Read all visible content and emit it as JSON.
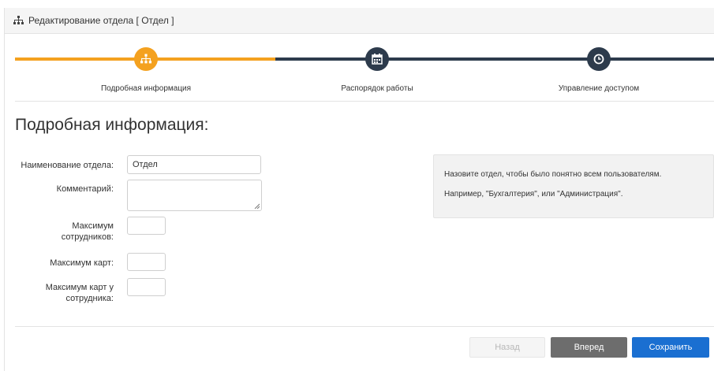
{
  "header": {
    "title": "Редактирование отдела [ Отдел ]",
    "icon": "sitemap-icon"
  },
  "wizard": {
    "progress_color": "#f4a11f",
    "pending_color": "#2d3b4c",
    "steps": [
      {
        "label": "Подробная информация",
        "icon": "sitemap-icon",
        "state": "active"
      },
      {
        "label": "Распорядок работы",
        "icon": "calendar-icon",
        "state": "pending"
      },
      {
        "label": "Управление доступом",
        "icon": "clock-icon",
        "state": "pending"
      }
    ]
  },
  "section": {
    "title": "Подробная информация:"
  },
  "form": {
    "name": {
      "label": "Наименование отдела:",
      "value": "Отдел"
    },
    "comment": {
      "label": "Комментарий:",
      "value": ""
    },
    "max_employees": {
      "label_line1": "Максимум",
      "label_line2": "сотрудников:",
      "value": ""
    },
    "max_cards": {
      "label": "Максимум карт:",
      "value": ""
    },
    "max_cards_per_employee": {
      "label_line1": "Максимум карт у",
      "label_line2": "сотрудника:",
      "value": ""
    }
  },
  "hint": {
    "line1": "Назовите отдел, чтобы было понятно всем пользователям.",
    "line2": "Например, \"Бухгалтерия\", или \"Администрация\"."
  },
  "buttons": {
    "back": "Назад",
    "next": "Вперед",
    "save": "Сохранить",
    "save_color": "#1a6fd1"
  }
}
